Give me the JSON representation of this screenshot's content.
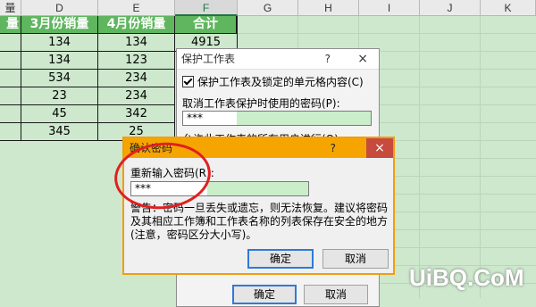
{
  "columns": {
    "partial": "量",
    "d": "D",
    "e": "E",
    "f": "F",
    "g": "G",
    "h": "H",
    "i": "I",
    "j": "J",
    "k": "K"
  },
  "table": {
    "headers": [
      "量",
      "3月份销量",
      "4月份销量",
      "合计"
    ],
    "rows": [
      [
        "134",
        "134",
        "4915"
      ],
      [
        "134",
        "123",
        ""
      ],
      [
        "534",
        "234",
        ""
      ],
      [
        "23",
        "234",
        ""
      ],
      [
        "45",
        "342",
        ""
      ],
      [
        "345",
        "25",
        ""
      ]
    ]
  },
  "protect_dialog": {
    "title": "保护工作表",
    "help": "?",
    "close": "×",
    "checkbox_label": "保护工作表及锁定的单元格内容(C)",
    "password_label": "取消工作表保护时使用的密码(P):",
    "password_value": "***",
    "allow_label": "允许此工作表的所有用户进行(O):",
    "ok_label": "确定",
    "cancel_label": "取消"
  },
  "confirm_dialog": {
    "title": "确认密码",
    "help": "?",
    "close": "×",
    "reenter_label": "重新输入密码(R):",
    "password_value": "***",
    "warning": "警告：密码一旦丢失或遗忘，则无法恢复。建议将密码及其相应工作簿和工作表名称的列表保存在安全的地方(注意，密码区分大小写)。",
    "ok_label": "确定",
    "cancel_label": "取消"
  },
  "watermark": "UiBQ.CoM",
  "colors": {
    "header_green": "#5fb65f",
    "sheet_bg": "#cde8cd",
    "dialog_accent": "#f6a500",
    "close_red": "#c64b3d"
  }
}
